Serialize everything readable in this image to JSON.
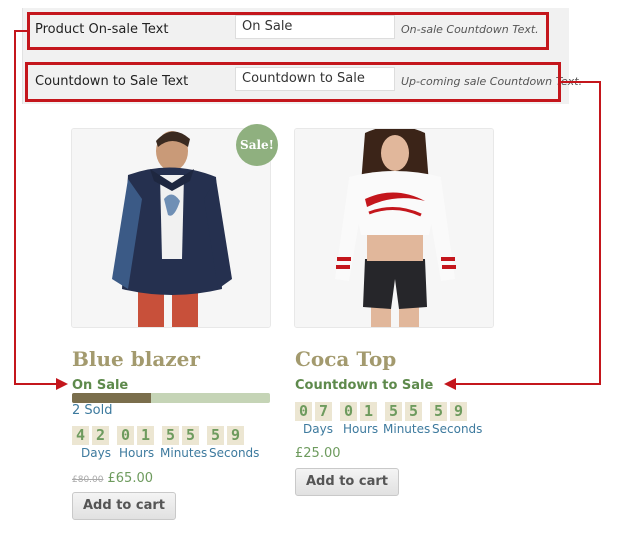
{
  "settings": {
    "rows": [
      {
        "label": "Product On-sale Text",
        "value": "On Sale",
        "description": "On-sale Countdown Text."
      },
      {
        "label": "Countdown to Sale Text",
        "value": "Countdown to Sale",
        "description": "Up-coming sale Countdown Text."
      }
    ]
  },
  "products": [
    {
      "title": "Blue blazer",
      "badge": "Sale!",
      "status": "On Sale",
      "sold_fraction": 0.4,
      "sold_text": "2 Sold",
      "countdown": {
        "days": [
          "4",
          "2"
        ],
        "hours": [
          "0",
          "1"
        ],
        "minutes": [
          "5",
          "5"
        ],
        "seconds": [
          "5",
          "9"
        ]
      },
      "countdown_labels": {
        "days": "Days",
        "hours": "Hours",
        "minutes": "Minutes",
        "seconds": "Seconds"
      },
      "old_price": "£80.00",
      "price": "£65.00",
      "button": "Add to cart"
    },
    {
      "title": "Coca Top",
      "status": "Countdown to Sale",
      "countdown": {
        "days": [
          "0",
          "7"
        ],
        "hours": [
          "0",
          "1"
        ],
        "minutes": [
          "5",
          "5"
        ],
        "seconds": [
          "5",
          "9"
        ]
      },
      "countdown_labels": {
        "days": "Days",
        "hours": "Hours",
        "minutes": "Minutes",
        "seconds": "Seconds"
      },
      "price": "£25.00",
      "button": "Add to cart"
    }
  ],
  "colors": {
    "highlight": "#c4161c",
    "accent": "#6e9b5e",
    "title": "#a39a6e",
    "link": "#3d7a9e"
  }
}
